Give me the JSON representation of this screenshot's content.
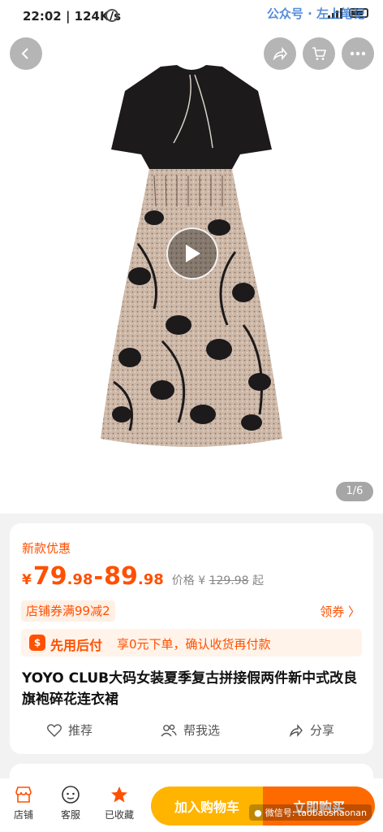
{
  "status_bar": {
    "time": "22:02 | 124K/s"
  },
  "watermark_top": "公众号 · 左上笔记",
  "hero": {
    "page_indicator": "1/6"
  },
  "card": {
    "promo_label": "新款优惠",
    "price": {
      "symbol": "¥",
      "low_int": "79",
      "low_dec": ".98",
      "dash": "-",
      "high_int": "89",
      "high_dec": ".98",
      "orig_label": "价格",
      "orig_symbol": "¥",
      "orig_value": "129.98",
      "orig_suffix": "起"
    },
    "coupon_tag": "店铺券满99减2",
    "coupon_link": "领券 〉",
    "paylater": {
      "icon_text": "$",
      "title": "先用后付",
      "desc": "享0元下单，确认收货再付款"
    },
    "product_title": "YOYO CLUB大码女装夏季复古拼接假两件新中式改良旗袍碎花连衣裙",
    "actions": {
      "recommend": "推荐",
      "help_choose": "帮我选",
      "share": "分享"
    }
  },
  "bottom_bar": {
    "tabs": {
      "shop": "店铺",
      "service": "客服",
      "favorite": "已收藏"
    },
    "add_to_cart": "加入购物车",
    "buy_now": "立即购买",
    "watermark": "微信号: taobaoshaonan"
  },
  "colors": {
    "accent": "#ff5000",
    "cart_button": "#ffb400",
    "buy_button": "#ff6a00"
  }
}
